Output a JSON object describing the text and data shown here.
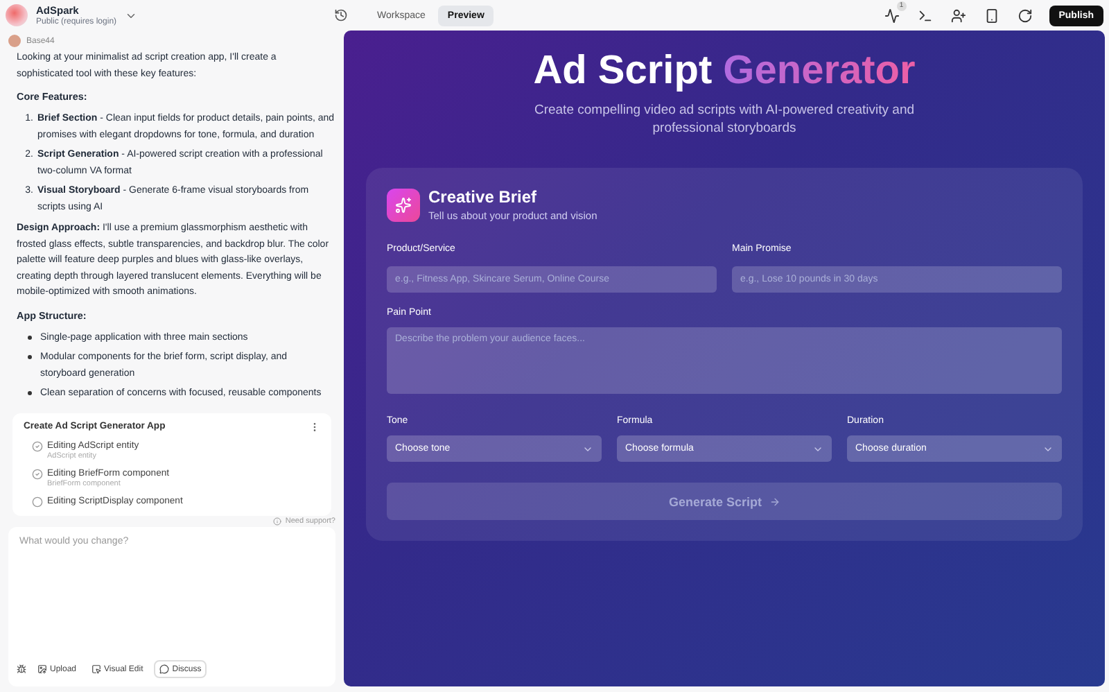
{
  "project": {
    "name": "AdSpark",
    "visibility": "Public (requires login)"
  },
  "view_tabs": [
    {
      "label": "Workspace",
      "selected": false
    },
    {
      "label": "Preview",
      "selected": true
    }
  ],
  "toolbar": {
    "activity_badge": "1",
    "publish": "Publish"
  },
  "chat": {
    "author": "Base44",
    "blocks": [
      {
        "kind": "paragraph",
        "text": "Looking at your minimalist ad script creation app, I'll create a sophisticated tool with these key features:"
      },
      {
        "kind": "heading",
        "text": "Core Features:"
      },
      {
        "kind": "numbered",
        "items": [
          {
            "number": "1.",
            "text": "**Brief Section** - Clean input fields for product details, pain points, and promises with elegant dropdowns for tone, formula, and duration"
          },
          {
            "number": "2.",
            "text": "**Script Generation** - AI-powered script creation with a professional two-column VA format"
          },
          {
            "number": "3.",
            "text": "**Visual Storyboard** - Generate 6-frame visual storyboards from scripts using AI"
          }
        ]
      },
      {
        "kind": "paragraph",
        "text": "**Design Approach:** I'll use a premium glassmorphism aesthetic with frosted glass effects, subtle transparencies, and backdrop blur. The color palette will feature deep purples and blues with glass-like overlays, creating depth through layered translucent elements. Everything will be mobile-optimized with smooth animations."
      },
      {
        "kind": "heading",
        "text": "App Structure:"
      },
      {
        "kind": "bullets",
        "items": [
          {
            "text": "Single-page application with three main sections"
          },
          {
            "text": "Modular components for the brief form, script display, and storyboard generation"
          },
          {
            "text": "Clean separation of concerns with focused, reusable components"
          }
        ]
      }
    ],
    "task": {
      "title": "Create Ad Script Generator App",
      "steps": [
        {
          "title": "Editing AdScript entity",
          "detail": "AdScript entity",
          "done": true
        },
        {
          "title": "Editing BriefForm component",
          "detail": "BriefForm component",
          "done": true
        },
        {
          "title": "Editing ScriptDisplay component",
          "done": false
        }
      ]
    },
    "support": "Need support?",
    "composer": {
      "placeholder": "What would you change?",
      "actions": [
        {
          "kind": "upload",
          "label": "Upload"
        },
        {
          "kind": "visual",
          "label": "Visual Edit"
        },
        {
          "kind": "discuss",
          "label": "Discuss"
        }
      ]
    }
  },
  "preview": {
    "title": "Ad Script",
    "title_accent": "Generator",
    "subtitle": "Create compelling video ad scripts with AI-powered creativity and professional storyboards",
    "card": {
      "title": "Creative Brief",
      "subtitle": "Tell us about your product and vision",
      "rows": [
        [
          {
            "kind": "input",
            "label": "Product/Service",
            "placeholder": "e.g., Fitness App, Skincare Serum, Online Course"
          },
          {
            "kind": "input",
            "label": "Main Promise",
            "placeholder": "e.g., Lose 10 pounds in 30 days"
          }
        ],
        [
          {
            "kind": "textarea",
            "label": "Pain Point",
            "placeholder": "Describe the problem your audience faces..."
          }
        ],
        [
          {
            "kind": "select",
            "label": "Tone",
            "value": "Choose tone"
          },
          {
            "kind": "select",
            "label": "Formula",
            "value": "Choose formula"
          },
          {
            "kind": "select",
            "label": "Duration",
            "value": "Choose duration"
          }
        ]
      ],
      "submit": {
        "label": "Generate Script",
        "disabled": true
      }
    }
  }
}
